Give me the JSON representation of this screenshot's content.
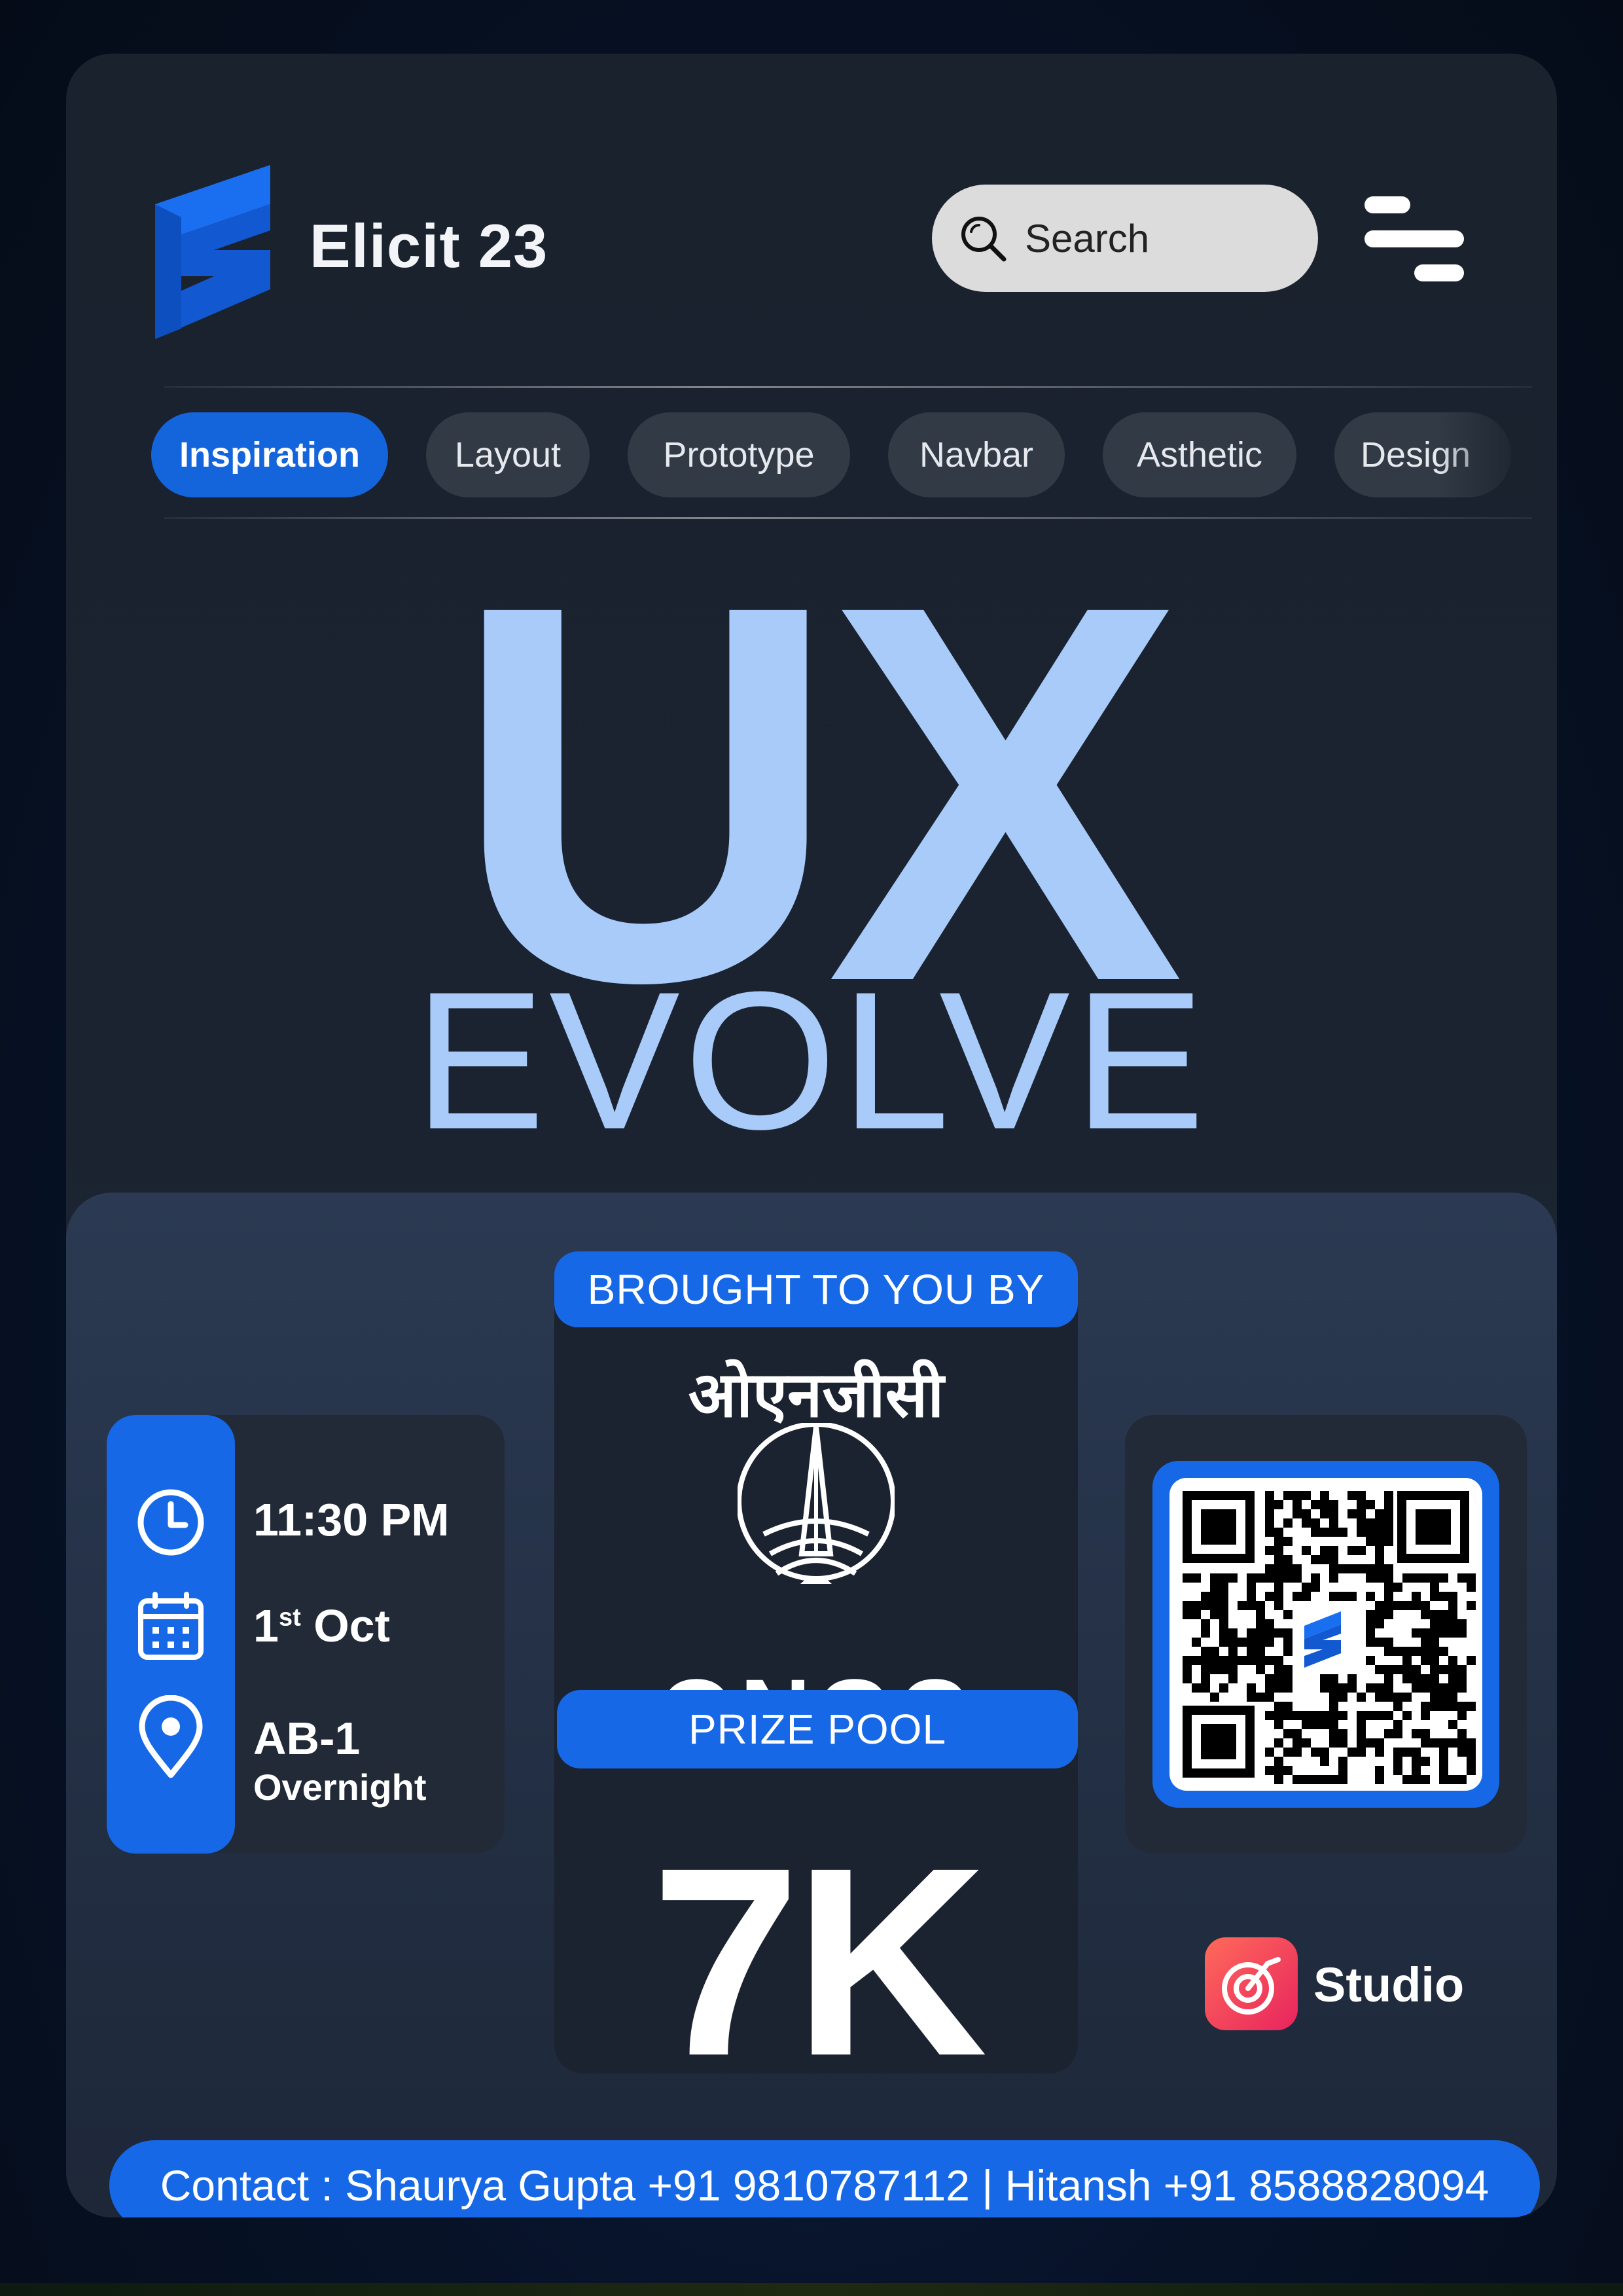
{
  "header": {
    "brand_title": "Elicit 23",
    "search_placeholder": "Search"
  },
  "tabs": [
    {
      "label": "Inspiration",
      "active": true
    },
    {
      "label": "Layout",
      "active": false
    },
    {
      "label": "Prototype",
      "active": false
    },
    {
      "label": "Navbar",
      "active": false
    },
    {
      "label": "Asthetic",
      "active": false
    },
    {
      "label": "Design",
      "active": false
    }
  ],
  "hero": {
    "line1": "UX",
    "line2": "EVOLVE"
  },
  "event": {
    "time": "11:30 PM",
    "date_day": "1",
    "date_suffix": "st",
    "date_month": "Oct",
    "venue": "AB-1",
    "venue_note": "Overnight"
  },
  "sponsor": {
    "heading": "BROUGHT TO YOU BY",
    "name_hindi": "ओएनजीसी",
    "name": "ONGC",
    "prize_label": "PRIZE POOL",
    "prize_value": "7K"
  },
  "partner": {
    "studio_label": "Studio"
  },
  "contact": {
    "text": "Contact : Shaurya Gupta +91 9810787112 | Hitansh +91 8588828094"
  },
  "colors": {
    "accent": "#1668e6",
    "hero_text": "#a8cbfa",
    "card_bg": "#1a222e"
  },
  "icons": [
    "elicit-logo-icon",
    "search-icon",
    "menu-icon",
    "clock-icon",
    "calendar-icon",
    "location-pin-icon",
    "ongc-emblem-icon",
    "qr-code",
    "studio-app-icon"
  ]
}
